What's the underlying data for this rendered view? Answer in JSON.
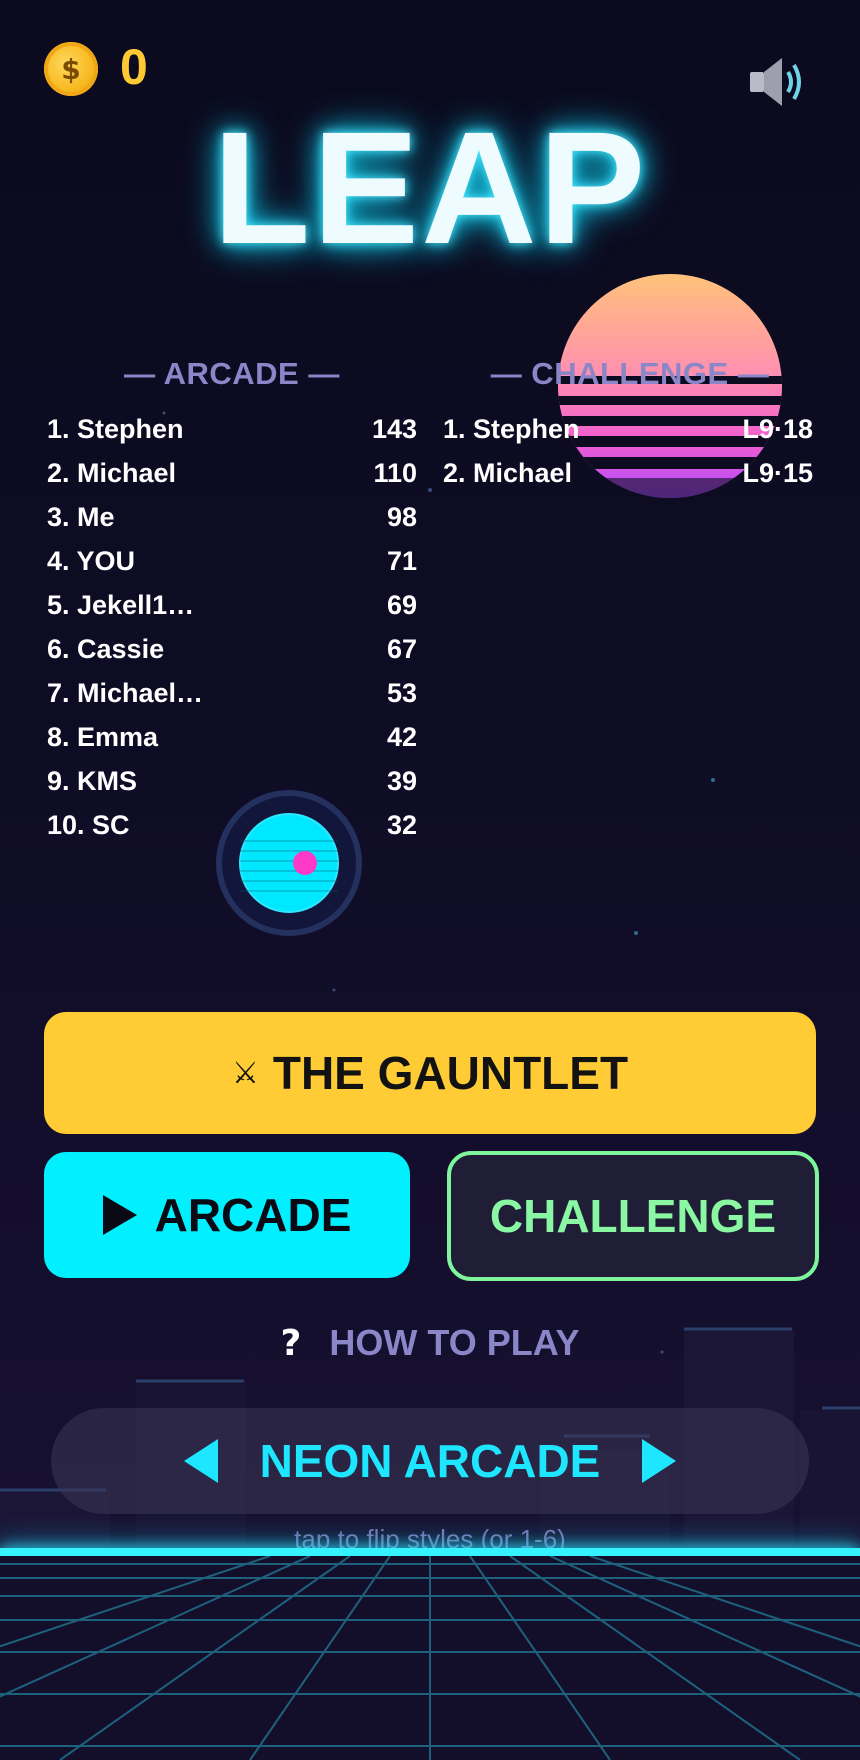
{
  "hud": {
    "coin_symbol": "$",
    "coins": "0",
    "sound_icon": "speaker-icon"
  },
  "title": "LEAP",
  "leaderboards": {
    "arcade": {
      "heading": "— ARCADE —",
      "entries": [
        {
          "name": "1. Stephen",
          "score": "143"
        },
        {
          "name": "2. Michael",
          "score": "110"
        },
        {
          "name": "3. Me",
          "score": "98"
        },
        {
          "name": "4. YOU",
          "score": "71"
        },
        {
          "name": "5. Jekell1…",
          "score": "69"
        },
        {
          "name": "6. Cassie",
          "score": "67"
        },
        {
          "name": "7. Michael…",
          "score": "53"
        },
        {
          "name": "8. Emma",
          "score": "42"
        },
        {
          "name": "9. KMS",
          "score": "39"
        },
        {
          "name": "10. SC",
          "score": "32"
        }
      ]
    },
    "challenge": {
      "heading": "— CHALLENGE —",
      "entries": [
        {
          "name": "1. Stephen",
          "score": "L9·18"
        },
        {
          "name": "2. Michael",
          "score": "L9·15"
        }
      ]
    }
  },
  "buttons": {
    "gauntlet_icon": "⚔",
    "gauntlet": "THE GAUNTLET",
    "arcade": "ARCADE",
    "challenge": "CHALLENGE",
    "how_icon": "?",
    "how_to_play": "HOW TO PLAY"
  },
  "style_selector": {
    "current": "NEON ARCADE",
    "hint": "tap to flip styles  (or 1-6)"
  },
  "colors": {
    "background": "#0c0b1f",
    "accent_cyan": "#00f0ff",
    "accent_yellow": "#ffcc36",
    "accent_green": "#7ef59a",
    "muted_text": "#8a86c8",
    "coin_gold": "#ffc933",
    "ball_dot": "#ff3ac8"
  }
}
